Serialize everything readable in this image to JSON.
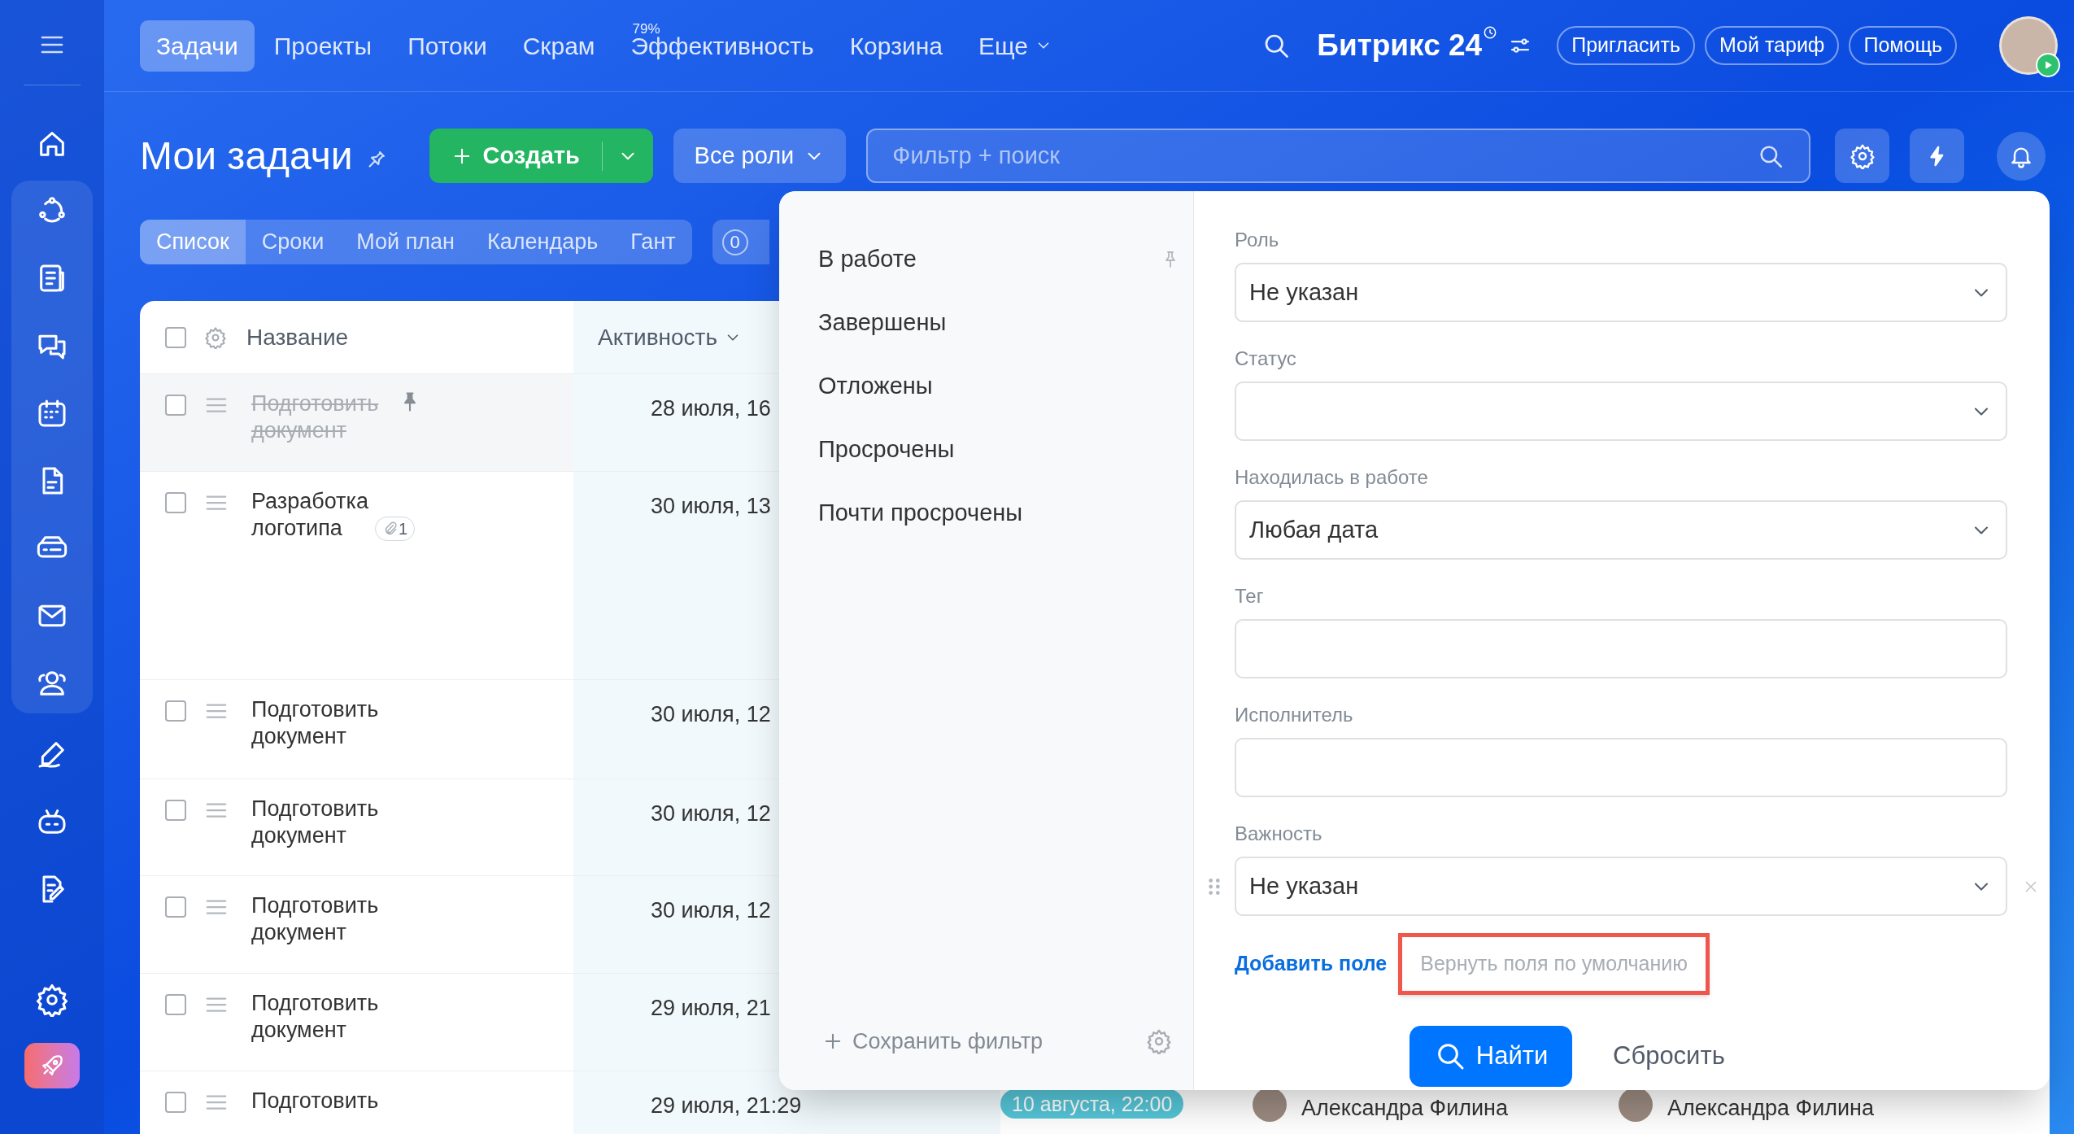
{
  "top_nav": {
    "tabs": [
      {
        "label": "Задачи",
        "selected": true
      },
      {
        "label": "Проекты",
        "selected": false
      },
      {
        "label": "Потоки",
        "selected": false
      },
      {
        "label": "Скрам",
        "selected": false
      },
      {
        "label": "Эффективность",
        "selected": false,
        "badge": "79%"
      },
      {
        "label": "Корзина",
        "selected": false
      }
    ],
    "more": "Еще",
    "logo": "Битрикс 24",
    "buttons": [
      "Пригласить",
      "Мой тариф",
      "Помощь"
    ]
  },
  "toolbar": {
    "title": "Мои задачи",
    "create_button": "Создать",
    "roles_button": "Все роли",
    "search": {
      "placeholder": "Фильтр + поиск"
    }
  },
  "view_tabs": [
    {
      "label": "Список",
      "selected": true
    },
    {
      "label": "Сроки",
      "selected": false
    },
    {
      "label": "Мой план",
      "selected": false
    },
    {
      "label": "Календарь",
      "selected": false
    },
    {
      "label": "Гант",
      "selected": false
    }
  ],
  "counter": "0",
  "table": {
    "header_checked": false,
    "columns": [
      "Название",
      "Активность"
    ],
    "rows": [
      {
        "name": "Подготовить документ",
        "completed": true,
        "pinned": true,
        "checked": false,
        "activity": "28 июля, 16"
      },
      {
        "name": "Разработка логотипа",
        "completed": false,
        "pinned": false,
        "checked": false,
        "activity": "30 июля, 13",
        "attachments": "1"
      },
      {
        "name": "Подготовить документ",
        "completed": false,
        "pinned": false,
        "checked": false,
        "activity": "30 июля, 12"
      },
      {
        "name": "Подготовить документ",
        "completed": false,
        "pinned": false,
        "checked": false,
        "activity": "30 июля, 12"
      },
      {
        "name": "Подготовить документ",
        "completed": false,
        "pinned": false,
        "checked": false,
        "activity": "30 июля, 12"
      },
      {
        "name": "Подготовить документ",
        "completed": false,
        "pinned": false,
        "checked": false,
        "activity": "29 июля, 21"
      },
      {
        "name": "Подготовить",
        "completed": false,
        "pinned": false,
        "checked": false,
        "activity": "29 июля, 21:29",
        "deadline": "10 августа, 22:00",
        "people": [
          "Александра Филина",
          "Александра Филина"
        ]
      }
    ]
  },
  "filter_popup": {
    "presets": [
      {
        "label": "В работе",
        "pinned": true
      },
      {
        "label": "Завершены",
        "pinned": false
      },
      {
        "label": "Отложены",
        "pinned": false
      },
      {
        "label": "Просрочены",
        "pinned": false
      },
      {
        "label": "Почти просрочены",
        "pinned": false
      }
    ],
    "save_filter": "Сохранить фильтр",
    "fields": [
      {
        "label": "Роль",
        "kind": "select",
        "value": "Не указан",
        "removable": false
      },
      {
        "label": "Статус",
        "kind": "select",
        "removable": false
      },
      {
        "label": "Находилась в работе",
        "kind": "select",
        "value": "Любая дата",
        "removable": false
      },
      {
        "label": "Тег",
        "kind": "text",
        "removable": false
      },
      {
        "label": "Исполнитель",
        "kind": "text",
        "removable": false
      },
      {
        "label": "Важность",
        "kind": "select",
        "value": "Не указан",
        "removable": true
      }
    ],
    "add_field": "Добавить поле",
    "reset_fields": {
      "label": "Вернуть поля по умолчанию",
      "highlighted": true
    },
    "find_button": "Найти",
    "reset_button": "Сбросить"
  }
}
